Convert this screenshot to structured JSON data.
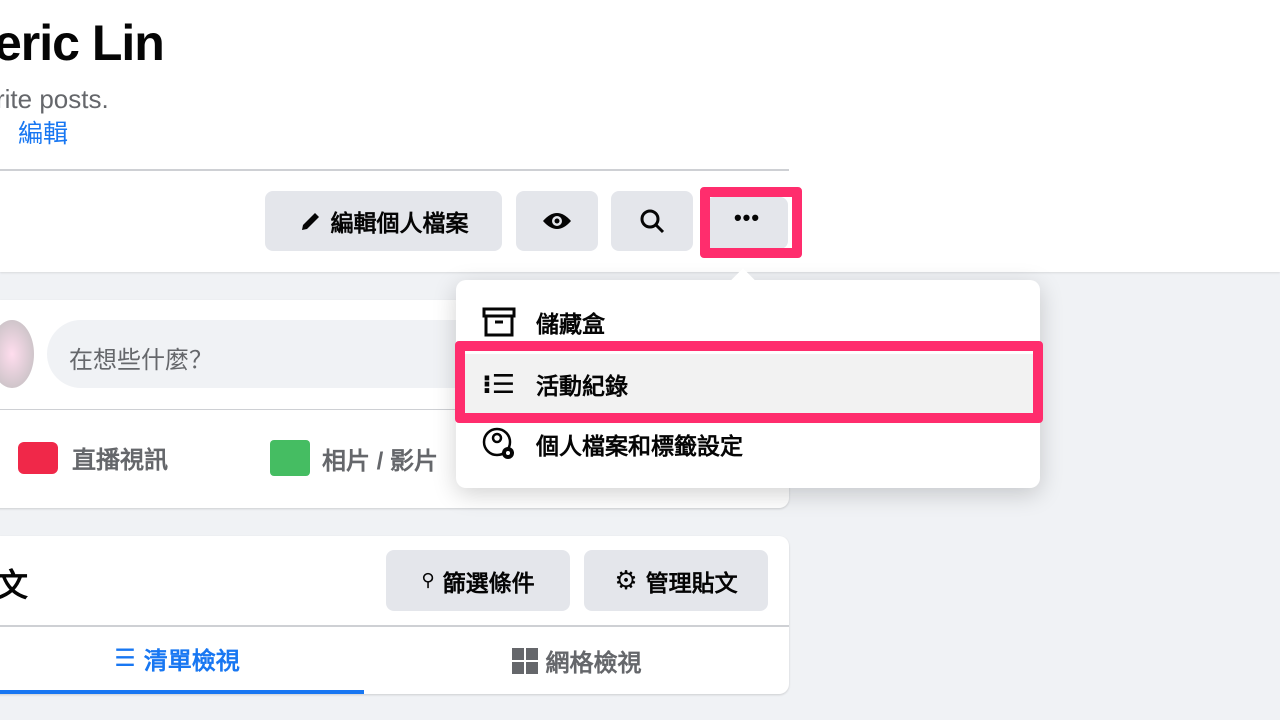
{
  "profile": {
    "name": "eric Lin",
    "bio": "rite posts.",
    "edit_link": "編輯"
  },
  "actions": {
    "edit_profile": "編輯個人檔案",
    "view_as_icon": "eye-icon",
    "search_icon": "search-icon",
    "more_icon": "more-icon"
  },
  "menu": {
    "items": [
      {
        "label": "儲藏盒",
        "icon": "archive-icon"
      },
      {
        "label": "活動紀錄",
        "icon": "list-icon"
      },
      {
        "label": "個人檔案和標籤設定",
        "icon": "profile-settings-icon"
      }
    ]
  },
  "composer": {
    "placeholder": "在想些什麼？",
    "live_video": "直播視訊",
    "photo_video": "相片 / 影片"
  },
  "posts": {
    "title": "文",
    "filter": "篩選條件",
    "manage": "管理貼文",
    "tabs": [
      {
        "label": "清單檢視",
        "active": true
      },
      {
        "label": "網格檢視",
        "active": false
      }
    ]
  },
  "colors": {
    "accent": "#1877f2",
    "highlight": "#ff2d6d",
    "live": "#f02849",
    "photo": "#45bd62"
  }
}
